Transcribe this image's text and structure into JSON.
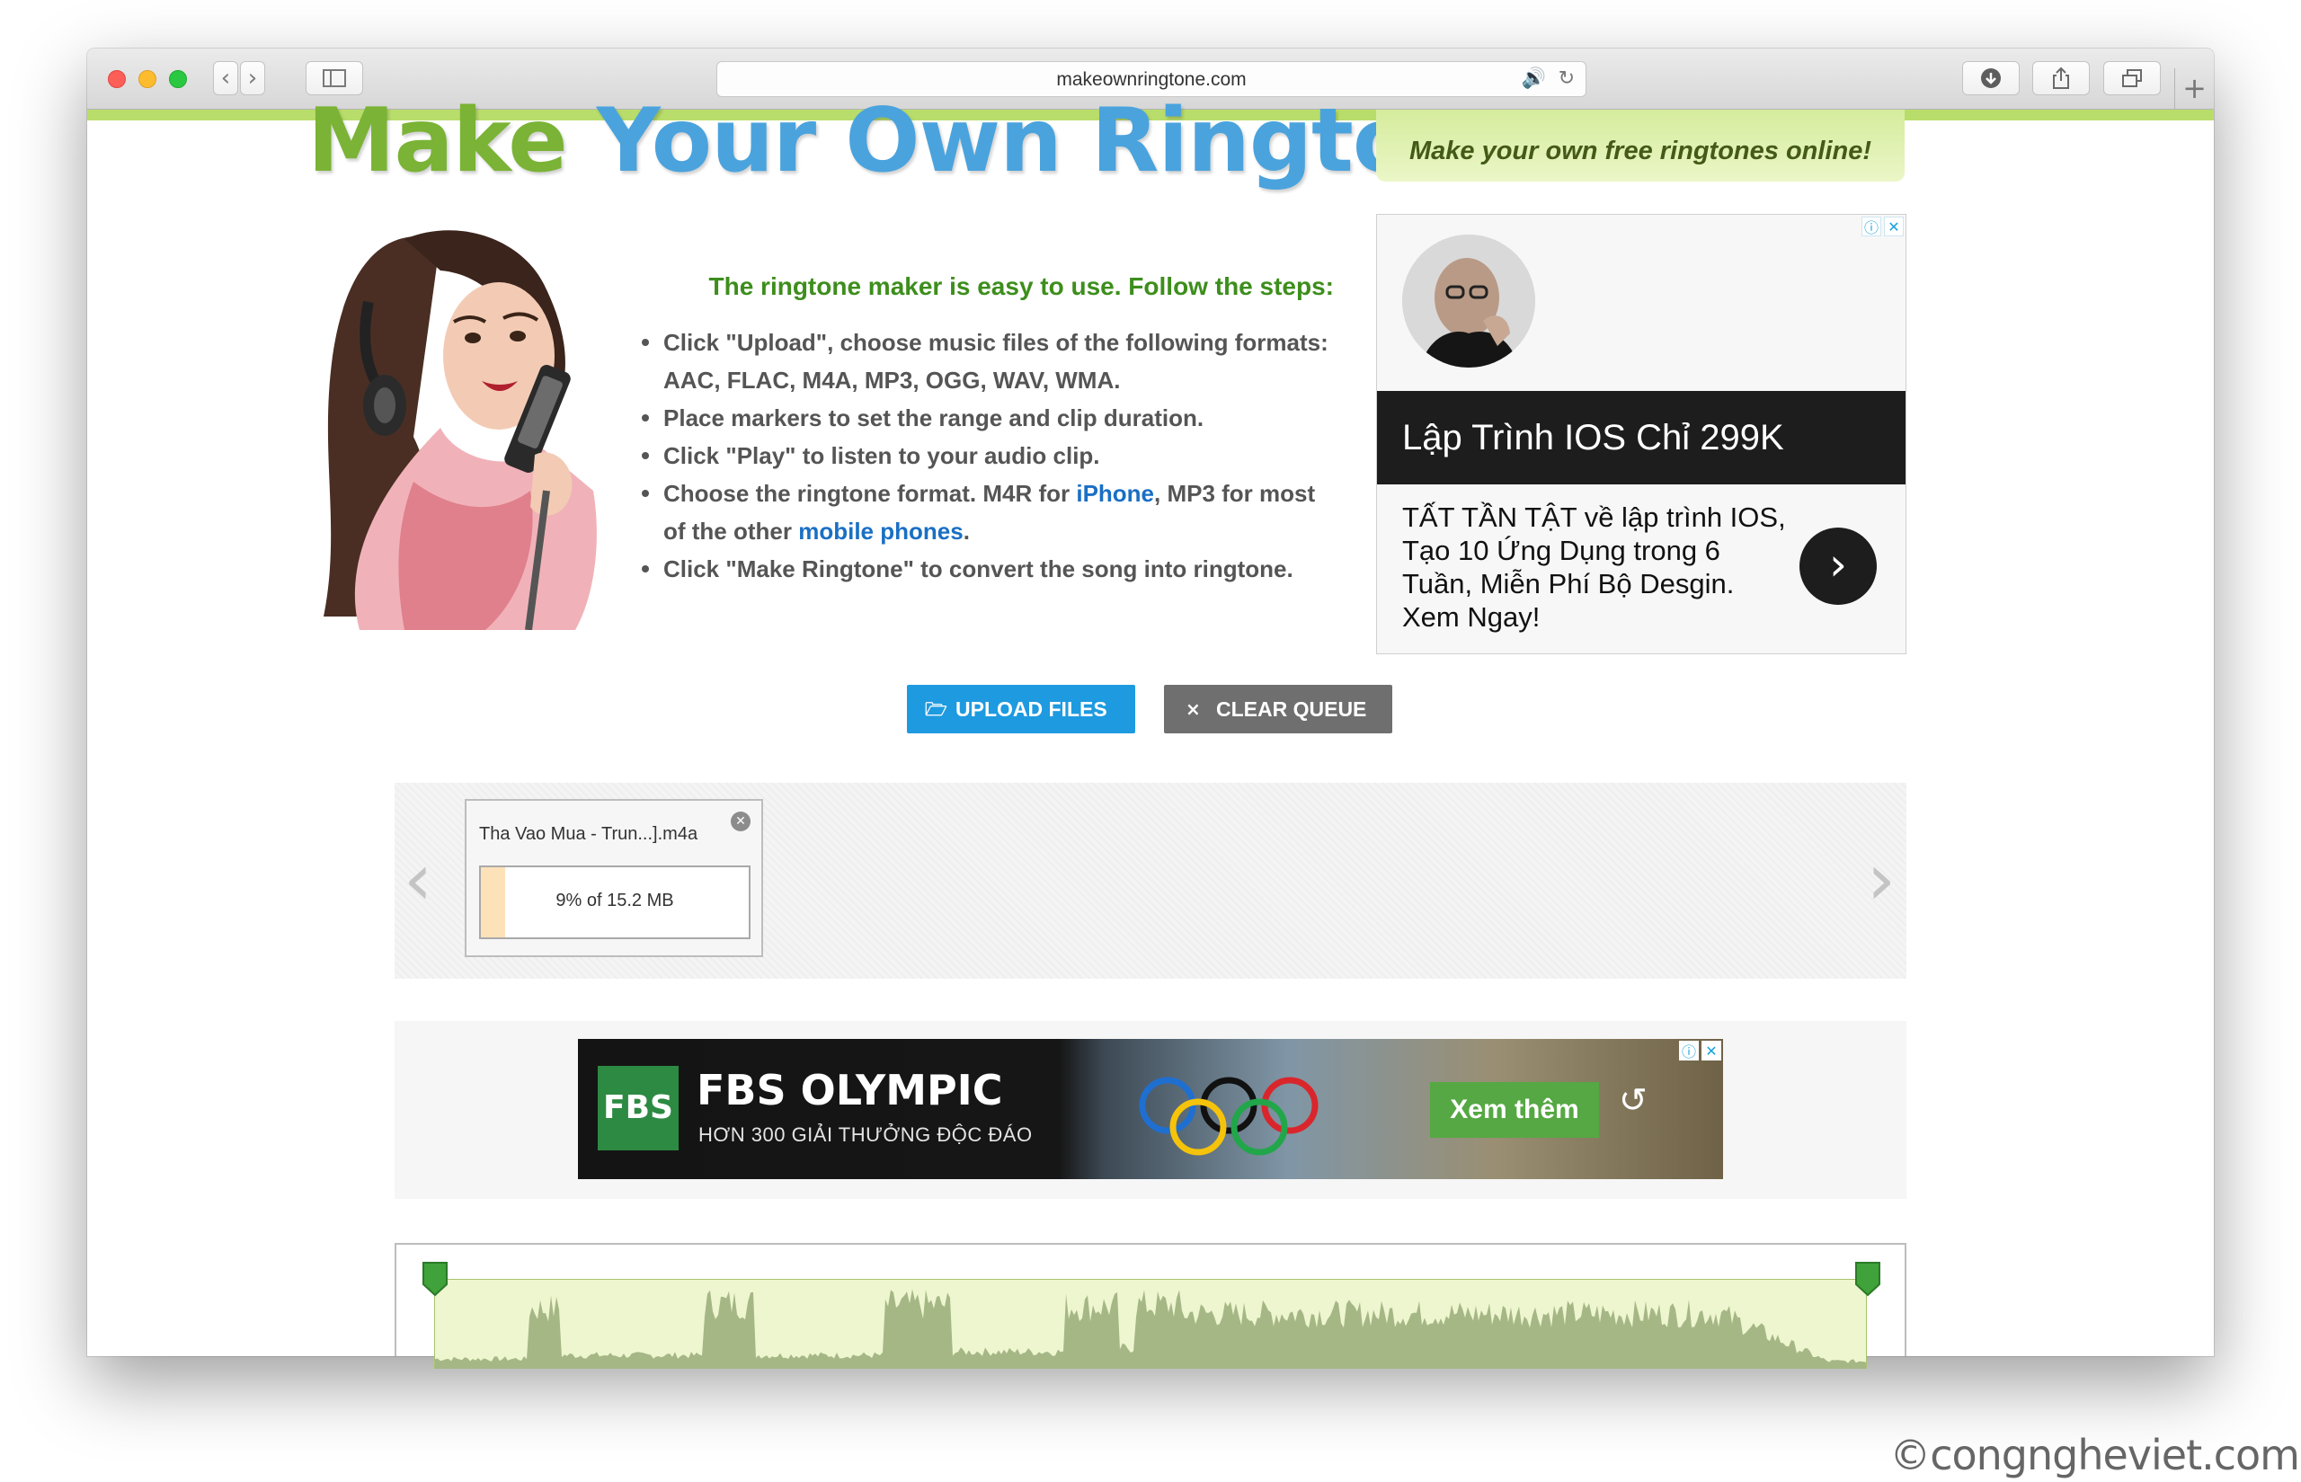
{
  "browser": {
    "url": "makeownringtone.com",
    "audio_icon": "speaker-icon",
    "reload_icon": "reload-icon"
  },
  "header": {
    "title_part1": "Make",
    "title_part2": "Your Own Ringtone",
    "tagline": "Make your own free ringtones online!"
  },
  "steps": {
    "title": "The ringtone maker is easy to use. Follow the steps:",
    "items": [
      "Click \"Upload\", choose music files of the following formats: AAC, FLAC, M4A, MP3, OGG, WAV, WMA.",
      "Place markers to set the range and clip duration.",
      "Click \"Play\" to listen to your audio clip."
    ],
    "item4_pre": "Choose the ringtone format. M4R for ",
    "item4_link1": "iPhone",
    "item4_mid": ", MP3 for most of the other ",
    "item4_link2": "mobile phones",
    "item4_post": ".",
    "item5": "Click \"Make Ringtone\" to convert the song into ringtone."
  },
  "ad": {
    "headline": "Lập Trình IOS Chỉ 299K",
    "body": "TẤT TẦN TẬT về lập trình IOS, Tạo 10 Ứng Dụng trong 6 Tuần, Miễn Phí Bộ Desgin. Xem Ngay!"
  },
  "buttons": {
    "upload": "UPLOAD FILES",
    "clear": "CLEAR QUEUE"
  },
  "queue": {
    "file_name": "Tha Vao Mua - Trun...].m4a",
    "progress_text": "9% of 15.2 MB",
    "progress_fraction": 0.09
  },
  "banner": {
    "logo": "FBS",
    "title": "FBS OLYMPIC",
    "subtitle": "HƠN 300 GIẢI THƯỞNG ĐỘC ĐÁO",
    "cta": "Xem thêm"
  },
  "watermark": "©congngheviet.com",
  "colors": {
    "accent_green": "#7ab335",
    "accent_blue": "#4aa3dd",
    "upload_blue": "#1e9ae0",
    "clear_gray": "#6f6f6f"
  }
}
